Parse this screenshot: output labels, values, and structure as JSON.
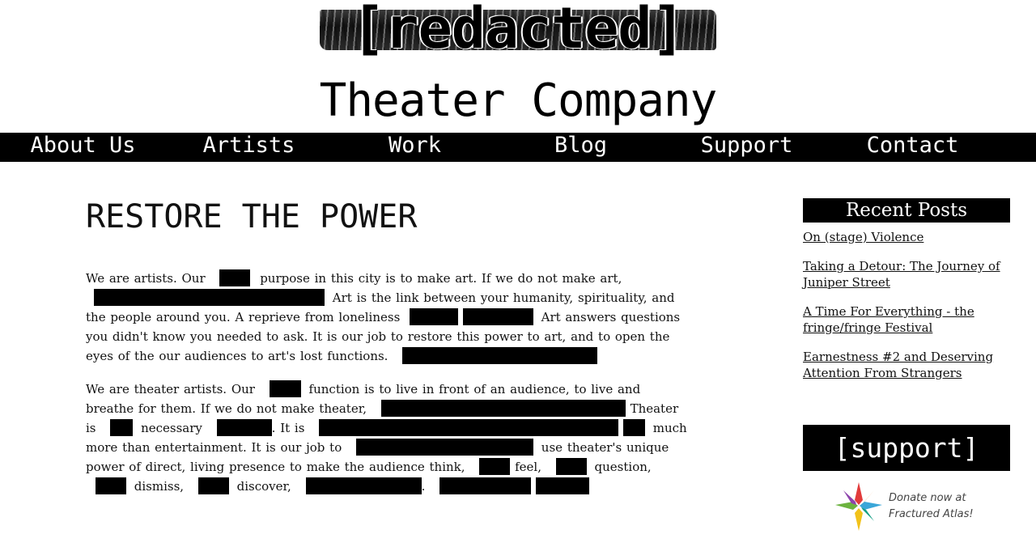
{
  "header": {
    "logo_text": "[redacted]",
    "company_name": "Theater Company"
  },
  "nav": {
    "items": [
      "About Us",
      "Artists",
      "Work",
      "Blog",
      "Support",
      "Contact"
    ]
  },
  "main": {
    "title": "RESTORE THE POWER",
    "p1": {
      "s1": "We are artists. Our",
      "s2": "purpose in this city is to make art. If we do not make art,",
      "s3": "Art is the link between your humanity,",
      "s4": "spirituality, and the people around you. A reprieve from loneliness",
      "s5": "Art answers questions you didn't know you needed to ask. It is our job to",
      "s6": "restore this power to art, and to open the eyes of the our audiences to art's lost",
      "s7": "functions."
    },
    "p2": {
      "s1": "We are theater artists. Our",
      "s2": "function is to live in front of an audience, to live",
      "s3": "and breathe for them. If we do not make theater,",
      "s4": "Theater is",
      "s5": "necessary",
      "s6": ". It is",
      "s7": "much more than entertainment. It is our job to",
      "s8": "use",
      "s9": "theater's unique power of direct, living presence to make the audience think,",
      "s10": "feel,",
      "s11": "question,",
      "s12": "dismiss,",
      "s13": "discover,",
      "s14": "."
    }
  },
  "sidebar": {
    "recent_posts_title": "Recent Posts",
    "posts": [
      "On (stage) Violence",
      "Taking a Detour: The Journey of Juniper Street",
      "A Time For Everything - the fringe/fringe Festival",
      "Earnestness #2 and Deserving Attention From Strangers"
    ],
    "support_label": "[support]",
    "donate_line1": "Donate now at",
    "donate_line2": "Fractured Atlas!",
    "donate_icon": "star-icon"
  },
  "colors": {
    "background": "#ffffff",
    "bar": "#000000",
    "text": "#111111",
    "redaction": "#000000"
  }
}
